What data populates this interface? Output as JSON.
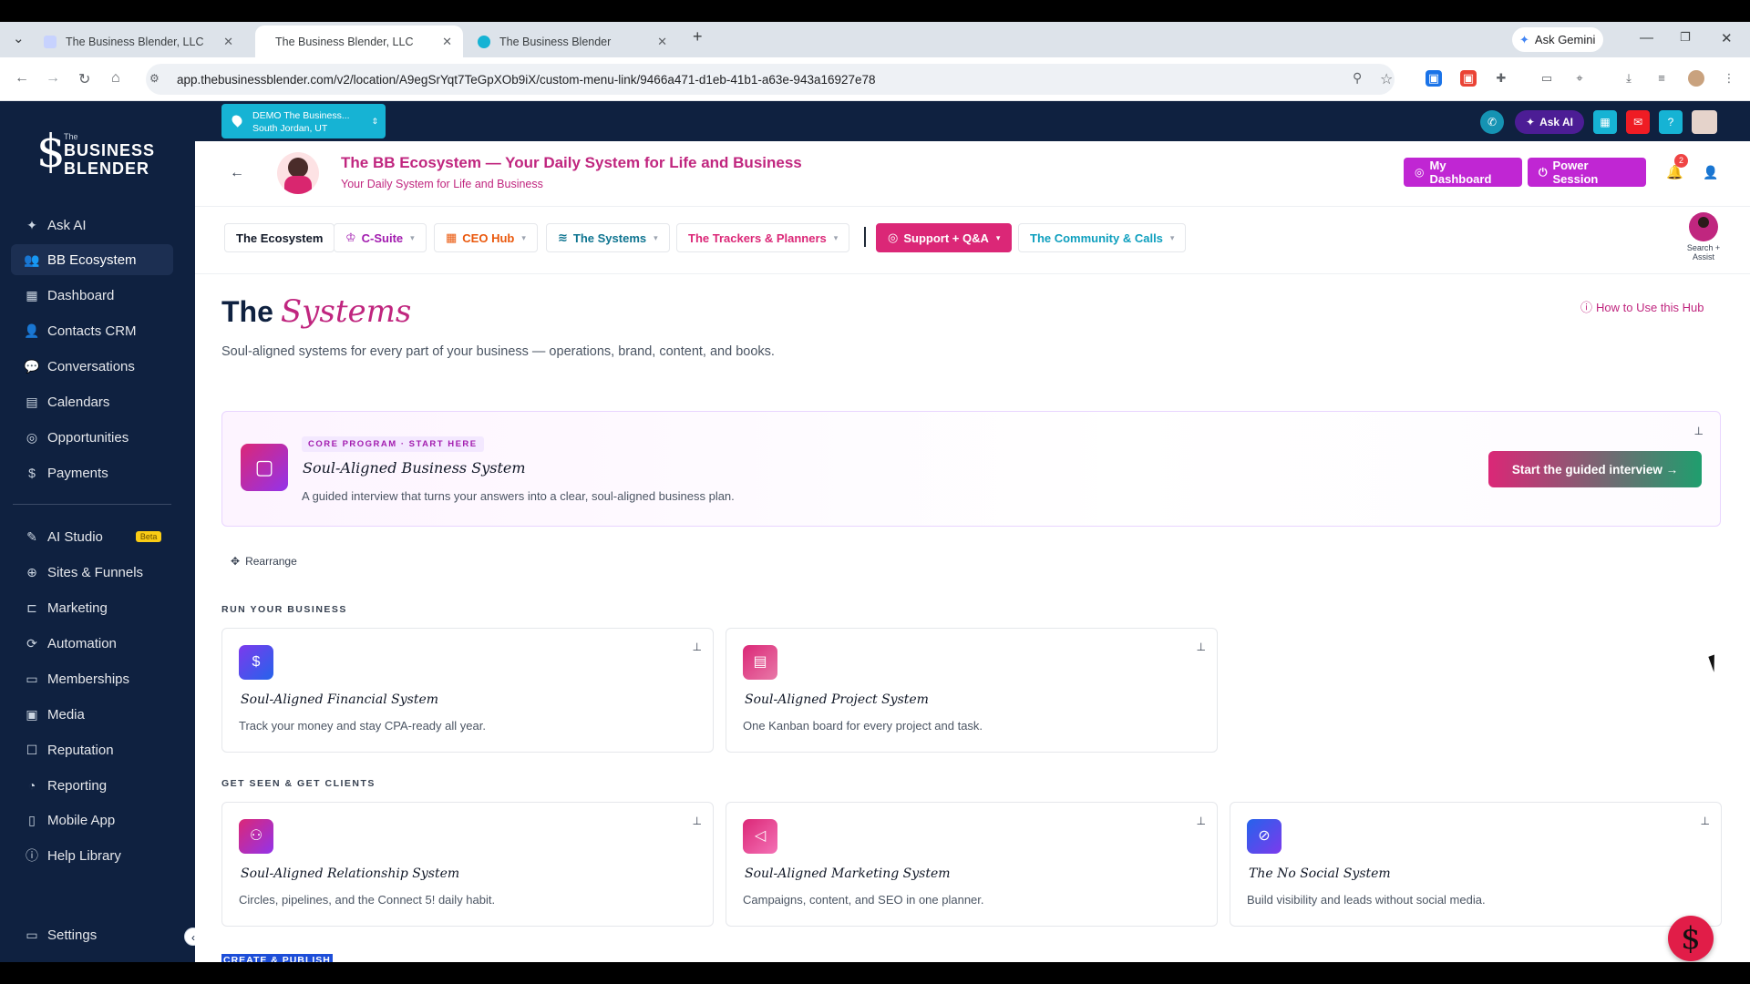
{
  "browser": {
    "tabs": [
      {
        "label": "The Business Blender, LLC"
      },
      {
        "label": "The Business Blender, LLC"
      },
      {
        "label": "The Business Blender"
      }
    ],
    "gemini_label": "Ask Gemini",
    "url": "app.thebusinessblender.com/v2/location/A9egSrYqt7TeGpXOb9iX/custom-menu-link/9466a471-d1eb-41b1-a63e-943a16927e78"
  },
  "sidebar": {
    "logo": {
      "the": "The",
      "line1": "BUSINESS",
      "line2": "BLENDER"
    },
    "items": [
      {
        "label": "Ask AI"
      },
      {
        "label": "BB Ecosystem"
      },
      {
        "label": "Dashboard"
      },
      {
        "label": "Contacts CRM"
      },
      {
        "label": "Conversations"
      },
      {
        "label": "Calendars"
      },
      {
        "label": "Opportunities"
      },
      {
        "label": "Payments"
      }
    ],
    "items2": [
      {
        "label": "AI Studio",
        "badge": "Beta"
      },
      {
        "label": "Sites & Funnels"
      },
      {
        "label": "Marketing"
      },
      {
        "label": "Automation"
      },
      {
        "label": "Memberships"
      },
      {
        "label": "Media"
      },
      {
        "label": "Reputation"
      },
      {
        "label": "Reporting"
      },
      {
        "label": "Mobile App"
      },
      {
        "label": "Help Library"
      }
    ],
    "settings": "Settings"
  },
  "topbar": {
    "location_name": "DEMO The Business...",
    "location_city": "South Jordan, UT",
    "ask_ai": "Ask AI"
  },
  "header": {
    "title": "The BB Ecosystem — Your Daily System for Life and Business",
    "subtitle": "Your Daily System for Life and Business",
    "my_dashboard": "My Dashboard",
    "power_session": "Power Session",
    "notifications": "2"
  },
  "nav_tabs": {
    "ecosystem": "The Ecosystem",
    "csuite": "C-Suite",
    "ceohub": "CEO Hub",
    "systems": "The Systems",
    "trackers": "The Trackers & Planners",
    "support": "Support + Q&A",
    "community": "The Community & Calls",
    "assist": "Search + Assist"
  },
  "page": {
    "title_the": "The",
    "title_script": "Systems",
    "how_to": "How to Use this Hub",
    "intro": "Soul-aligned systems for every part of your business — operations, brand, content, and books."
  },
  "core": {
    "tag": "CORE PROGRAM · START HERE",
    "title": "Soul-Aligned Business System",
    "desc": "A guided interview that turns your answers into a clear, soul-aligned business plan.",
    "button": "Start the guided interview →"
  },
  "rearrange": "Rearrange",
  "sections": {
    "run": "RUN YOUR BUSINESS",
    "seen": "GET SEEN & GET CLIENTS",
    "create": "CREATE & PUBLISH"
  },
  "cards": [
    {
      "title": "Soul-Aligned Financial System",
      "desc": "Track your money and stay CPA-ready all year.",
      "icon": "dollar-icon"
    },
    {
      "title": "Soul-Aligned Project System",
      "desc": "One Kanban board for every project and task.",
      "icon": "document-icon"
    },
    {
      "title": "Soul-Aligned Relationship System",
      "desc": "Circles, pipelines, and the Connect 5! daily habit.",
      "icon": "people-icon"
    },
    {
      "title": "Soul-Aligned Marketing System",
      "desc": "Campaigns, content, and SEO in one planner.",
      "icon": "megaphone-icon"
    },
    {
      "title": "The No Social System",
      "desc": "Build visibility and leads without social media.",
      "icon": "no-signal-icon"
    }
  ],
  "colors": {
    "brand": "#c0267f",
    "navy": "#0f2140",
    "accent": "#16b3d4"
  }
}
